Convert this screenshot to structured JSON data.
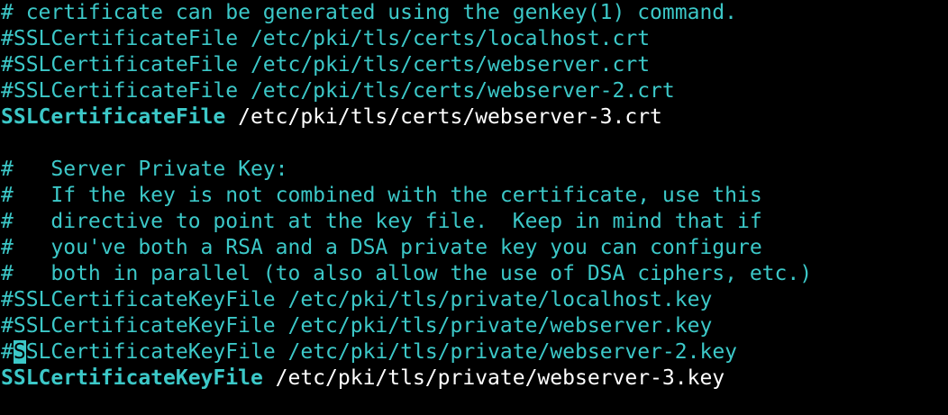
{
  "colors": {
    "background": "#000000",
    "comment": "#3cc8c8",
    "directive": "#3cc8c8",
    "value": "#ffffff",
    "cursor": "#3cc8c8"
  },
  "lines": {
    "l1": "# certificate can be generated using the genkey(1) command.",
    "l2": "#SSLCertificateFile /etc/pki/tls/certs/localhost.crt",
    "l3": "#SSLCertificateFile /etc/pki/tls/certs/webserver.crt",
    "l4": "#SSLCertificateFile /etc/pki/tls/certs/webserver-2.crt",
    "l5_directive": "SSLCertificateFile",
    "l5_value": " /etc/pki/tls/certs/webserver-3.crt",
    "l7": "#   Server Private Key:",
    "l8": "#   If the key is not combined with the certificate, use this",
    "l9": "#   directive to point at the key file.  Keep in mind that if",
    "l10": "#   you've both a RSA and a DSA private key you can configure",
    "l11": "#   both in parallel (to also allow the use of DSA ciphers, etc.)",
    "l12": "#SSLCertificateKeyFile /etc/pki/tls/private/localhost.key",
    "l13": "#SSLCertificateKeyFile /etc/pki/tls/private/webserver.key",
    "l14_hash": "#",
    "l14_cursor": "S",
    "l14_rest": "SLCertificateKeyFile /etc/pki/tls/private/webserver-2.key",
    "l15_directive": "SSLCertificateKeyFile",
    "l15_value": " /etc/pki/tls/private/webserver-3.key"
  }
}
